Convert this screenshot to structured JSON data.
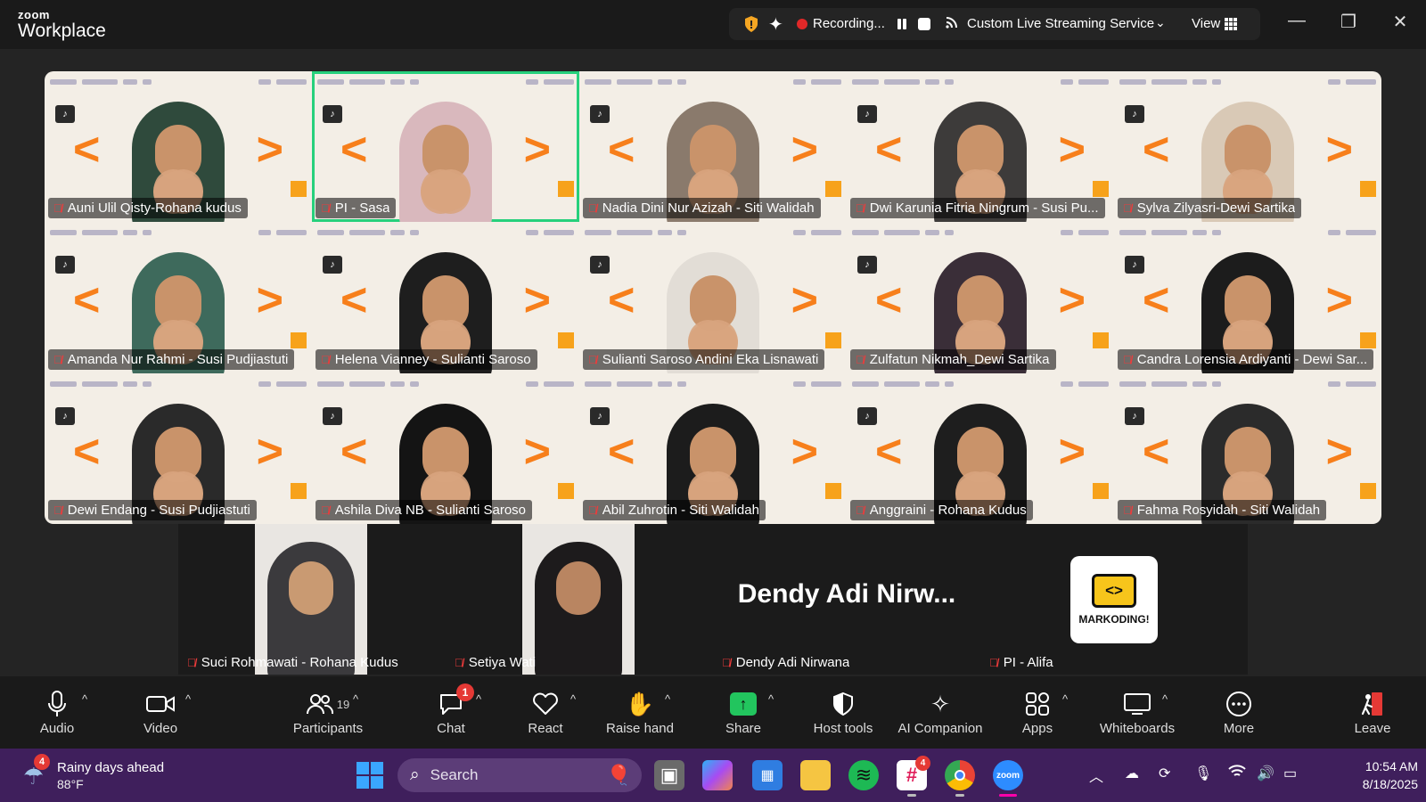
{
  "app": {
    "brand_top": "zoom",
    "brand_name": "Workplace"
  },
  "topbar": {
    "recording_label": "Recording...",
    "streaming_label": "Custom Live Streaming Service",
    "view_label": "View"
  },
  "gallery": {
    "tiles": [
      {
        "name": "Auni Ulil Qisty-Rohana kudus",
        "hijab": "#2f4a3c",
        "active": false
      },
      {
        "name": "PI - Sasa",
        "hijab": "#d9b8bd",
        "active": true
      },
      {
        "name": "Nadia Dini Nur Azizah - Siti Walidah",
        "hijab": "#8a7a6c",
        "active": false
      },
      {
        "name": "Dwi Karunia Fitria Ningrum - Susi Pu...",
        "hijab": "#3d3b3a",
        "active": false
      },
      {
        "name": "Sylva Zilyasri-Dewi Sartika",
        "hijab": "#d9c9b6",
        "active": false
      },
      {
        "name": "Amanda Nur Rahmi - Susi Pudjiastuti",
        "hijab": "#3e6a5c",
        "active": false
      },
      {
        "name": "Helena Vianney - Sulianti Saroso",
        "hijab": "#1e1e1e",
        "active": false
      },
      {
        "name": "Sulianti Saroso Andini Eka Lisnawati",
        "hijab": "#e2ddd6",
        "active": false
      },
      {
        "name": "Zulfatun Nikmah_Dewi Sartika",
        "hijab": "#3a2e38",
        "active": false
      },
      {
        "name": "Candra Lorensia Ardiyanti - Dewi Sar...",
        "hijab": "#1c1c1c",
        "active": false
      },
      {
        "name": "Dewi Endang - Susi Pudjiastuti",
        "hijab": "#2a2a2a",
        "active": false
      },
      {
        "name": "Ashila Diva NB - Sulianti Saroso",
        "hijab": "#141414",
        "active": false
      },
      {
        "name": "Abil Zuhrotin - Siti Walidah",
        "hijab": "#1c1c1c",
        "active": false
      },
      {
        "name": "Anggraini - Rohana Kudus",
        "hijab": "#1e1e1e",
        "active": false
      },
      {
        "name": "Fahma Rosyidah - Siti Walidah",
        "hijab": "#2b2b2b",
        "active": false
      }
    ],
    "bottom_row": {
      "suci": "Suci Rohmawati - Rohana Kudus",
      "setiya": "Setiya Wati",
      "dendy_big": "Dendy Adi Nirw...",
      "dendy": "Dendy Adi Nirwana",
      "alifa": "PI - Alifa",
      "alifa_logo_text": "MARKODING!"
    }
  },
  "toolbar": {
    "audio": "Audio",
    "video": "Video",
    "participants": "Participants",
    "participants_count": "19",
    "chat": "Chat",
    "chat_badge": "1",
    "react": "React",
    "raise_hand": "Raise hand",
    "share": "Share",
    "host_tools": "Host tools",
    "ai_companion": "AI Companion",
    "apps": "Apps",
    "whiteboards": "Whiteboards",
    "more": "More",
    "leave": "Leave"
  },
  "taskbar": {
    "weather_title": "Rainy days ahead",
    "weather_temp": "88°F",
    "weather_badge": "4",
    "search_placeholder": "Search",
    "slack_badge": "4",
    "time": "10:54 AM",
    "date": "8/18/2025"
  }
}
